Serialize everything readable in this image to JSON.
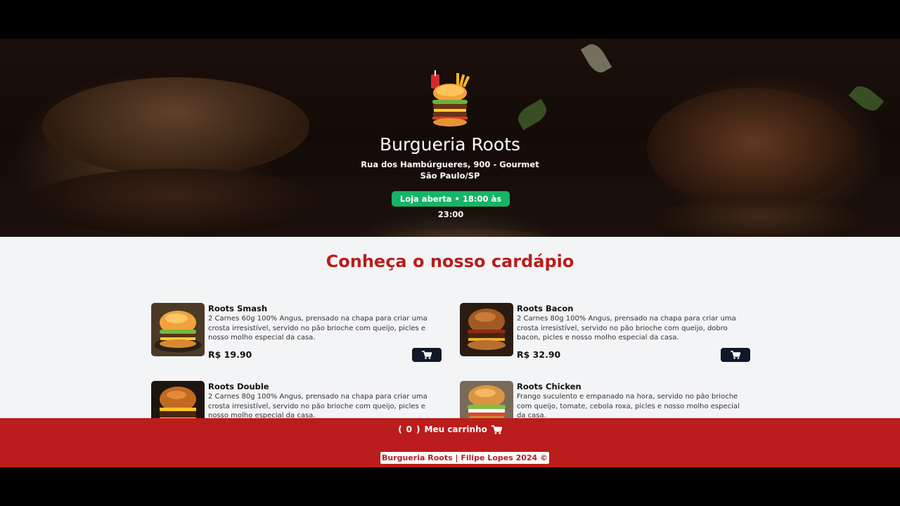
{
  "header": {
    "title": "Burgueria Roots",
    "address_line1": "Rua dos Hambúrgueres, 900 - Gourmet",
    "address_line2": "São Paulo/SP",
    "status": "Loja aberta • 18:00 às 23:00",
    "status_color": "#16b466"
  },
  "menu": {
    "title": "Conheça o nosso cardápio",
    "items": [
      {
        "name": "Roots Smash",
        "description": "2 Carnes 60g 100% Angus, prensado na chapa para criar uma crosta irresistível, servido no pão brioche com queijo, picles e nosso molho especial da casa.",
        "price": "R$ 19.90",
        "icon": "cart-icon"
      },
      {
        "name": "Roots Bacon",
        "description": "2 Carnes 80g 100% Angus, prensado na chapa para criar uma crosta irresistível, servido no pão brioche com queijo, dobro bacon, picles e nosso molho especial da casa.",
        "price": "R$ 32.90",
        "icon": "cart-icon"
      },
      {
        "name": "Roots Double",
        "description": "2 Carnes 80g 100% Angus, prensado na chapa para criar uma crosta irresistível, servido no pão brioche com queijo, picles e nosso molho especial da casa.",
        "price": "",
        "icon": "cart-icon"
      },
      {
        "name": "Roots Chicken",
        "description": "Frango suculento e empanado na hora, servido no pão brioche com queijo, tomate, cebola roxa, picles e nosso molho especial da casa.",
        "price": "",
        "icon": "cart-icon"
      }
    ]
  },
  "footer": {
    "cart_open": "(",
    "cart_count": "0",
    "cart_close": ")",
    "cart_label": "Meu carrinho",
    "copyright": "Burgueria Roots | Filipe Lopes 2024 ©",
    "accent_color": "#bb1c1c"
  }
}
